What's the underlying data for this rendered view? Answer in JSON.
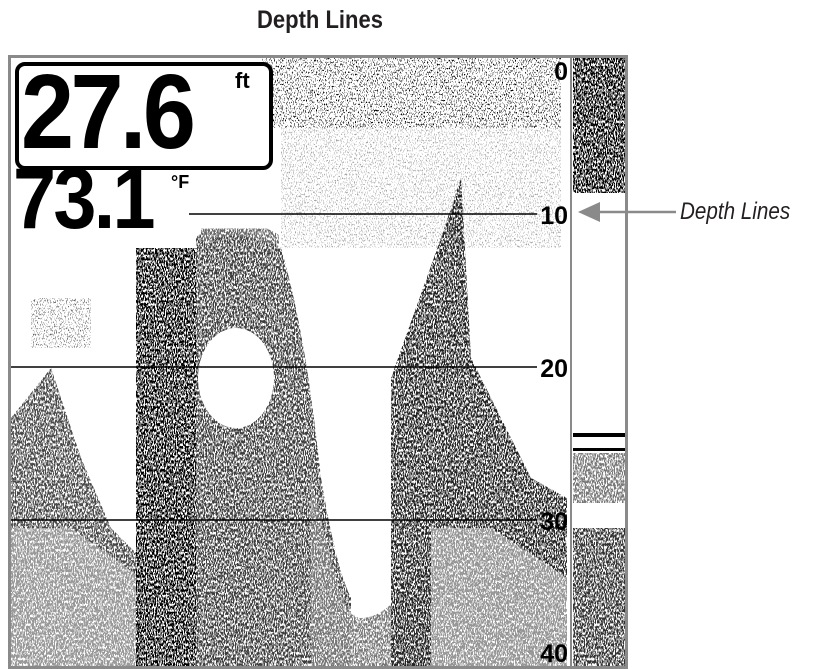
{
  "page": {
    "title": "Depth Lines"
  },
  "readouts": {
    "depth_value": "27.6",
    "depth_unit": "ft",
    "temperature_value": "73.1",
    "temperature_unit": "°F"
  },
  "scale": {
    "labels": [
      "0",
      "10",
      "20",
      "30",
      "40"
    ]
  },
  "callout": {
    "label": "Depth Lines"
  },
  "colors": {
    "frame": "#8a8a8a",
    "ink": "#000000",
    "callout_arrow": "#8a8a8a"
  }
}
